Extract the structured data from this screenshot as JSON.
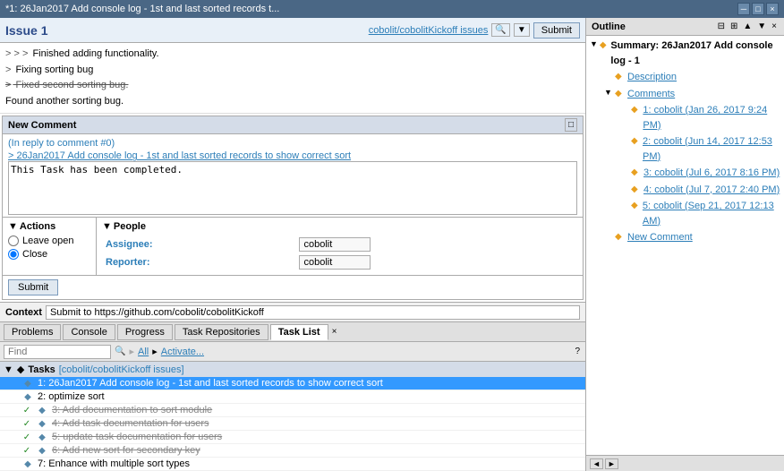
{
  "titleBar": {
    "title": "*1: 26Jan2017 Add console log - 1st and last sorted records t...",
    "closeLabel": "×"
  },
  "issue": {
    "title": "Issue 1",
    "repoLink": "cobolit/cobolitKickoff issues",
    "submitLabel": "Submit",
    "content": {
      "lines": [
        {
          "text": "> > > Finished adding functionality.",
          "indent": 1,
          "style": "normal"
        },
        {
          "text": "> Fixing sorting bug",
          "indent": 1,
          "style": "normal"
        },
        {
          "text": "> Fixed second sorting bug.",
          "indent": 1,
          "style": "strikethrough"
        },
        {
          "text": "Found another sorting bug.",
          "indent": 0,
          "style": "normal"
        }
      ]
    }
  },
  "newComment": {
    "header": "New Comment",
    "replyTo": "(In reply to comment #0)",
    "commentLink": "> 26Jan2017 Add console log - 1st and last sorted records to show correct sort",
    "bodyText": "This Task has been completed."
  },
  "actions": {
    "header": "Actions",
    "options": [
      {
        "id": "leave-open",
        "label": "Leave open",
        "checked": true
      },
      {
        "id": "close",
        "label": "Close",
        "checked": false
      }
    ]
  },
  "people": {
    "header": "People",
    "assigneeLabel": "Assignee:",
    "assigneeValue": "cobolit",
    "reporterLabel": "Reporter:",
    "reporterValue": "cobolit"
  },
  "submitRow": {
    "submitLabel": "Submit"
  },
  "context": {
    "label": "Context",
    "value": "Submit to https://github.com/cobolit/cobolitKickoff"
  },
  "tabs": [
    {
      "label": "Problems",
      "active": false
    },
    {
      "label": "Console",
      "active": false
    },
    {
      "label": "Progress",
      "active": false
    },
    {
      "label": "Task Repositories",
      "active": false
    },
    {
      "label": "Task List",
      "active": true
    }
  ],
  "taskToolbar": {
    "findPlaceholder": "Find",
    "allLabel": "All",
    "activateLabel": "Activate..."
  },
  "taskGroup": {
    "label": "Tasks",
    "name": "[cobolit/cobolitKickoff issues]"
  },
  "tasks": [
    {
      "id": 1,
      "text": "1: 26Jan2017 Add console log - 1st and last sorted records to show correct sort",
      "selected": true,
      "done": false,
      "strikethrough": false,
      "indent": 1
    },
    {
      "id": 2,
      "text": "2: optimize sort",
      "selected": false,
      "done": false,
      "strikethrough": false,
      "indent": 1
    },
    {
      "id": 3,
      "text": "3: Add documentation to sort module",
      "selected": false,
      "done": true,
      "strikethrough": true,
      "indent": 1
    },
    {
      "id": 4,
      "text": "4: Add task documentation for users",
      "selected": false,
      "done": true,
      "strikethrough": true,
      "indent": 1
    },
    {
      "id": 5,
      "text": "5: update task documentation for users",
      "selected": false,
      "done": true,
      "strikethrough": true,
      "indent": 1
    },
    {
      "id": 6,
      "text": "6: Add new sort for secondary key",
      "selected": false,
      "done": true,
      "strikethrough": true,
      "indent": 1
    },
    {
      "id": 7,
      "text": "7: Enhance with multiple sort types",
      "selected": false,
      "done": false,
      "strikethrough": false,
      "indent": 1
    }
  ],
  "outline": {
    "title": "Outline",
    "summaryLabel": "Summary: 26Jan2017 Add console log - 1",
    "descriptionLabel": "Description",
    "commentsLabel": "Comments",
    "comments": [
      {
        "label": "1: cobolit (Jan 26, 2017 9:24 PM)"
      },
      {
        "label": "2: cobolit (Jun 14, 2017 12:53 PM)"
      },
      {
        "label": "3: cobolit (Jul 6, 2017 8:16 PM)"
      },
      {
        "label": "4: cobolit (Jul 7, 2017 2:40 PM)"
      },
      {
        "label": "5: cobolit (Sep 21, 2017 12:13 AM)"
      }
    ],
    "newCommentLabel": "New Comment"
  }
}
